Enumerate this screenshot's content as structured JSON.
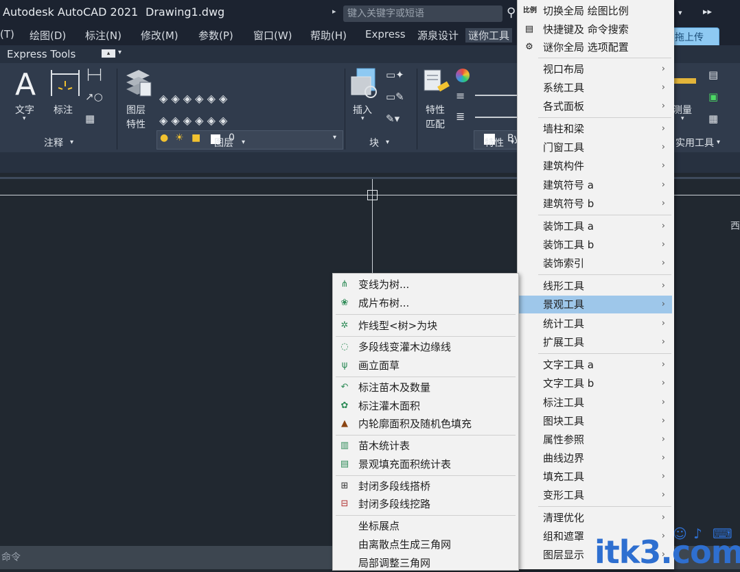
{
  "title_bar": {
    "app_title": "Autodesk AutoCAD 2021",
    "file_name": "Drawing1.dwg",
    "search_placeholder": "键入关键字或短语"
  },
  "menubar": {
    "items": [
      "(T)",
      "绘图(D)",
      "标注(N)",
      "修改(M)",
      "参数(P)",
      "窗口(W)",
      "帮助(H)",
      "Express",
      "源泉设计",
      "谜你工具"
    ]
  },
  "upload_button": "拖上传",
  "tabrow": {
    "tab": "Express Tools"
  },
  "ribbon": {
    "annotate": {
      "text_label": "文字",
      "dim_label": "标注",
      "panel": "注释"
    },
    "layers": {
      "props_label_1": "图层",
      "props_label_2": "特性",
      "current_layer": "0",
      "panel": "图层"
    },
    "block": {
      "insert_label": "插入",
      "panel": "块"
    },
    "properties": {
      "match_label_1": "特性",
      "match_label_2": "匹配",
      "by_text": "By",
      "panel": "特性"
    },
    "utilities": {
      "measure_label": "测量",
      "panel": "实用工具"
    }
  },
  "side_text": "西",
  "cmdline": {
    "placeholder": "命令"
  },
  "menu_main": {
    "items": [
      "切换全局 绘图比例",
      "快捷键及 命令搜索",
      "谜你全局 选项配置",
      "视口布局",
      "系统工具",
      "各式面板",
      "墙柱和梁",
      "门窗工具",
      "建筑构件",
      "建筑符号 a",
      "建筑符号 b",
      "装饰工具 a",
      "装饰工具 b",
      "装饰索引",
      "线形工具",
      "景观工具",
      "统计工具",
      "扩展工具",
      "文字工具 a",
      "文字工具 b",
      "标注工具",
      "图块工具",
      "属性参照",
      "曲线边界",
      "填充工具",
      "变形工具",
      "清理优化",
      "组和遮罩",
      "图层显示"
    ],
    "highlighted": "景观工具",
    "arrow": "›"
  },
  "menu_sub": {
    "items": [
      "变线为树...",
      "成片布树...",
      "炸线型<树>为块",
      "多段线变灌木边缘线",
      "画立面草",
      "标注苗木及数量",
      "标注灌木面积",
      "内轮廓面积及随机色填充",
      "苗木统计表",
      "景观填充面积统计表",
      "封闭多段线搭桥",
      "封闭多段线挖路",
      "坐标展点",
      "由离散点生成三角网",
      "局部调整三角网"
    ]
  },
  "watermark": "itk3.com",
  "colors": {
    "ui_bg": "#303b4c",
    "canvas": "#212830",
    "menu_bg": "#f2f2f2",
    "menu_highlight": "#9ec7ea",
    "watermark": "#2e6fd0"
  }
}
